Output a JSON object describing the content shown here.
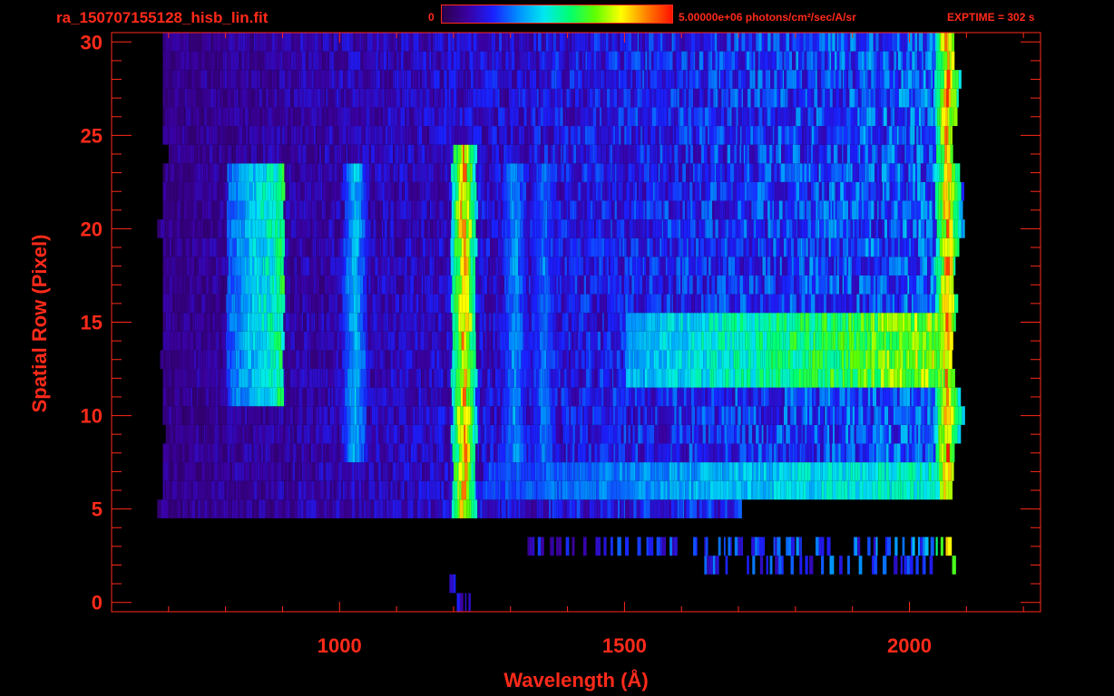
{
  "header": {
    "file_title": "ra_150707155128_hisb_lin.fit",
    "colorbar_min": "0",
    "colorbar_max": "5.00000e+06 photons/cm²/sec/A/sr",
    "exptime": "EXPTIME = 302 s"
  },
  "colors": {
    "axis": "#ff2a1a",
    "background": "#000000",
    "colormap": [
      "#2a0048",
      "#3a00a0",
      "#1a20ff",
      "#0090ff",
      "#00e8f0",
      "#00ff70",
      "#60ff00",
      "#ffff00",
      "#ff8000",
      "#ff1000"
    ]
  },
  "chart_data": {
    "type": "heatmap",
    "title": "ra_150707155128_hisb_lin.fit",
    "xlabel": "Wavelength (Å)",
    "ylabel": "Spatial Row (Pixel)",
    "xlim": [
      600,
      2230
    ],
    "ylim": [
      -0.5,
      30.5
    ],
    "x_ticks": [
      1000,
      1500,
      2000
    ],
    "y_ticks": [
      0,
      5,
      10,
      15,
      20,
      25,
      30
    ],
    "x_tick_labels": [
      "1000",
      "1500",
      "2000"
    ],
    "y_tick_labels": [
      "0",
      "5",
      "10",
      "15",
      "20",
      "25",
      "30"
    ],
    "colorbar_range": [
      0,
      5000000
    ],
    "colorbar_unit": "photons/cm²/sec/A/sr",
    "exposure_time_s": 302,
    "grid": false,
    "row_wavelength_ranges": [
      {
        "row": 0,
        "from": 1195,
        "to": 1230
      },
      {
        "row": 1,
        "from": 1190,
        "to": 1200
      },
      {
        "row": 2,
        "from": 1640,
        "to": 2075
      },
      {
        "row": 3,
        "from": 1310,
        "to": 2075
      },
      {
        "row": 4,
        "from": 0,
        "to": 0
      },
      {
        "row": 5,
        "from": 680,
        "to": 1705
      },
      {
        "row": 6,
        "from": 690,
        "to": 2075
      },
      {
        "row": 7,
        "from": 690,
        "to": 2075
      },
      {
        "row": 8,
        "from": 690,
        "to": 2075
      },
      {
        "row": 9,
        "from": 695,
        "to": 2090
      },
      {
        "row": 10,
        "from": 690,
        "to": 2095
      },
      {
        "row": 11,
        "from": 690,
        "to": 2090
      },
      {
        "row": 12,
        "from": 690,
        "to": 2080
      },
      {
        "row": 13,
        "from": 685,
        "to": 2075
      },
      {
        "row": 14,
        "from": 690,
        "to": 2075
      },
      {
        "row": 15,
        "from": 690,
        "to": 2080
      },
      {
        "row": 16,
        "from": 690,
        "to": 2085
      },
      {
        "row": 17,
        "from": 690,
        "to": 2075
      },
      {
        "row": 18,
        "from": 690,
        "to": 2080
      },
      {
        "row": 19,
        "from": 690,
        "to": 2085
      },
      {
        "row": 20,
        "from": 680,
        "to": 2095
      },
      {
        "row": 21,
        "from": 690,
        "to": 2090
      },
      {
        "row": 22,
        "from": 690,
        "to": 2095
      },
      {
        "row": 23,
        "from": 690,
        "to": 2085
      },
      {
        "row": 24,
        "from": 700,
        "to": 2075
      },
      {
        "row": 25,
        "from": 690,
        "to": 2075
      },
      {
        "row": 26,
        "from": 690,
        "to": 2080
      },
      {
        "row": 27,
        "from": 690,
        "to": 2085
      },
      {
        "row": 28,
        "from": 690,
        "to": 2090
      },
      {
        "row": 29,
        "from": 690,
        "to": 2075
      },
      {
        "row": 30,
        "from": 690,
        "to": 2075
      }
    ],
    "features": [
      {
        "name": "Lyman-alpha emission",
        "wavelength": 1216,
        "rows": [
          5,
          24
        ],
        "peak_level": 0.95
      },
      {
        "name": "bright band",
        "wavelength_range": [
          1500,
          2070
        ],
        "rows": [
          12,
          15
        ],
        "peak_level": 0.8
      },
      {
        "name": "bright band",
        "wavelength_range": [
          1250,
          2070
        ],
        "rows": [
          6,
          7
        ],
        "peak_level": 0.55
      },
      {
        "name": "arc",
        "wavelength_range": [
          800,
          900
        ],
        "rows": [
          11,
          23
        ],
        "peak_level": 0.6
      },
      {
        "name": "vertical line",
        "wavelength": 1025,
        "rows": [
          8,
          23
        ],
        "peak_level": 0.45
      },
      {
        "name": "vertical line",
        "wavelength": 1305,
        "rows": [
          8,
          23
        ],
        "peak_level": 0.4
      },
      {
        "name": "vertical line",
        "wavelength": 1356,
        "rows": [
          8,
          23
        ],
        "peak_level": 0.35
      },
      {
        "name": "edge",
        "wavelength": 2065,
        "rows": [
          2,
          30
        ],
        "peak_level": 0.95
      }
    ]
  }
}
